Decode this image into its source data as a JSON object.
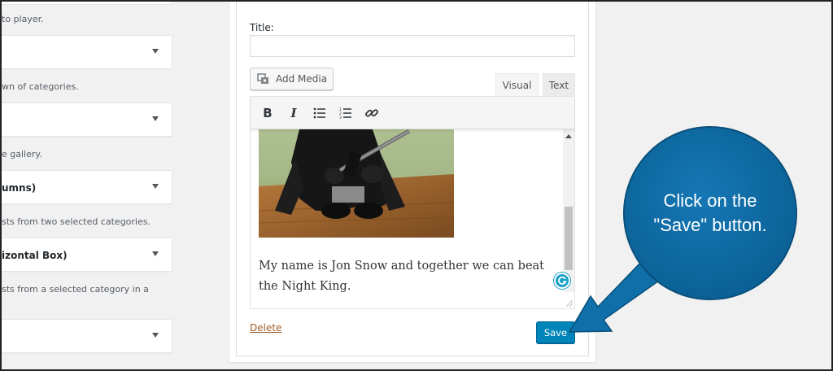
{
  "left_column": {
    "descriptions": [
      "to player.",
      "wn of categories.",
      "e gallery.",
      "sts from two selected categories.",
      "sts from a selected category in a"
    ],
    "widgets": [
      {
        "title": ""
      },
      {
        "title": ""
      },
      {
        "title": "umns)"
      },
      {
        "title": "izontal Box)"
      },
      {
        "title": ""
      }
    ]
  },
  "form": {
    "title_label": "Title:",
    "title_value": "",
    "add_media_label": "Add Media",
    "tabs": {
      "visual": "Visual",
      "text": "Text"
    },
    "toolbar": {
      "bold": "B",
      "italic": "I"
    },
    "content_text": "My name is Jon Snow and together we can beat the Night King.",
    "delete_label": "Delete",
    "save_label": "Save"
  },
  "callout": {
    "text_line1": "Click on the",
    "text_line2": "\"Save\" button.",
    "color": "#0f6fa8"
  },
  "colors": {
    "save_button": "#0085ba",
    "delete_link": "#a05d2a",
    "grammarly": "#15a0c8"
  }
}
